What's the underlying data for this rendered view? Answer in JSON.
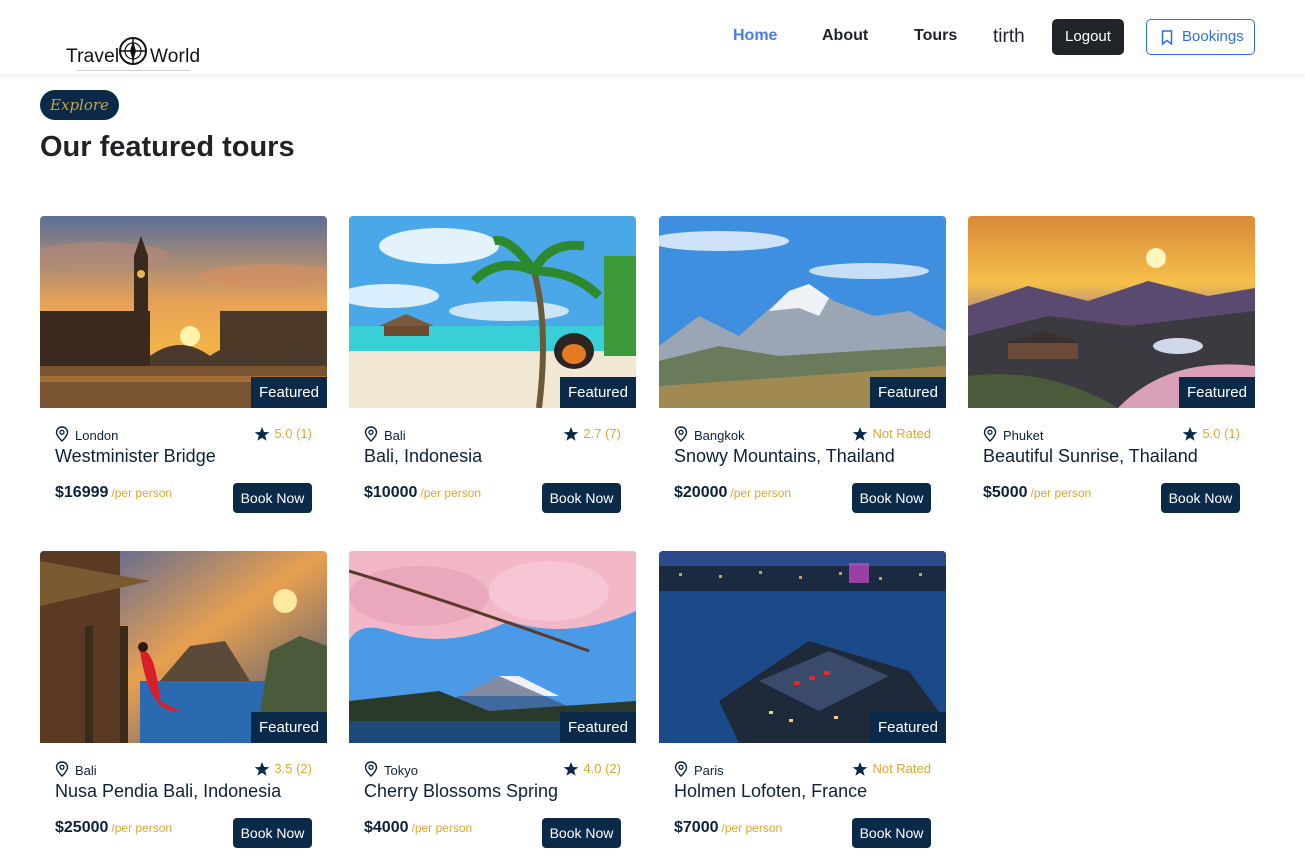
{
  "header": {
    "logo_left": "Travel",
    "logo_right": "World",
    "nav": [
      "Home",
      "About",
      "Tours"
    ],
    "active_nav": "Home",
    "user": "tirth",
    "logout_label": "Logout",
    "bookings_label": "Bookings"
  },
  "section": {
    "pill": "Explore",
    "title": "Our featured tours"
  },
  "colors": {
    "primary": "#0b2a4a",
    "accent": "#e0a62d",
    "nav_active": "#4a7cf0",
    "bookings": "#2f6fe8"
  },
  "cards": [
    {
      "city": "London",
      "rating": "5.0 (1)",
      "title": "Westminister Bridge",
      "price": "$16999",
      "per": "/per person",
      "badge": "Featured",
      "button": "Book Now"
    },
    {
      "city": "Bali",
      "rating": "2.7 (7)",
      "title": "Bali, Indonesia",
      "price": "$10000",
      "per": "/per person",
      "badge": "Featured",
      "button": "Book Now"
    },
    {
      "city": "Bangkok",
      "rating": "Not Rated",
      "title": "Snowy Mountains, Thailand",
      "price": "$20000",
      "per": "/per person",
      "badge": "Featured",
      "button": "Book Now"
    },
    {
      "city": "Phuket",
      "rating": "5.0 (1)",
      "title": "Beautiful Sunrise, Thailand",
      "price": "$5000",
      "per": "/per person",
      "badge": "Featured",
      "button": "Book Now"
    },
    {
      "city": "Bali",
      "rating": "3.5 (2)",
      "title": "Nusa Pendia Bali, Indonesia",
      "price": "$25000",
      "per": "/per person",
      "badge": "Featured",
      "button": "Book Now"
    },
    {
      "city": "Tokyo",
      "rating": "4.0 (2)",
      "title": "Cherry Blossoms Spring",
      "price": "$4000",
      "per": "/per person",
      "badge": "Featured",
      "button": "Book Now"
    },
    {
      "city": "Paris",
      "rating": "Not Rated",
      "title": "Holmen Lofoten, France",
      "price": "$7000",
      "per": "/per person",
      "badge": "Featured",
      "button": "Book Now"
    }
  ]
}
